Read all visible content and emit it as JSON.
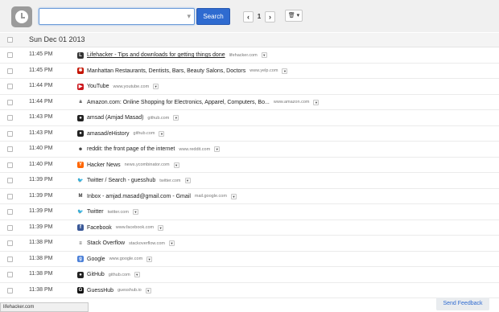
{
  "search": {
    "value": "",
    "placeholder": "",
    "button_label": "Search"
  },
  "pager": {
    "prev": "‹",
    "page": "1",
    "next": "›"
  },
  "trash": {
    "icon": "trash-icon",
    "label": "🗑 ▾"
  },
  "date_header": "Sun Dec 01 2013",
  "rows": [
    {
      "time": "11:45 PM",
      "title": "Lifehacker - Tips and downloads for getting things done",
      "domain": "lifehacker.com",
      "icon": "lifehacker-icon",
      "color": "#333333",
      "glyph": "L",
      "underline": true
    },
    {
      "time": "11:45 PM",
      "title": "Manhattan Restaurants, Dentists, Bars, Beauty Salons, Doctors",
      "domain": "www.yelp.com",
      "icon": "yelp-icon",
      "color": "#c41200",
      "glyph": "✱"
    },
    {
      "time": "11:44 PM",
      "title": "YouTube",
      "domain": "www.youtube.com",
      "icon": "youtube-icon",
      "color": "#cc181e",
      "glyph": "▶"
    },
    {
      "time": "11:44 PM",
      "title": "Amazon.com: Online Shopping for Electronics, Apparel, Computers, Bo...",
      "domain": "www.amazon.com",
      "icon": "amazon-icon",
      "color": "#ffffff",
      "glyph": "a"
    },
    {
      "time": "11:43 PM",
      "title": "amsad (Amjad Masad)",
      "domain": "github.com",
      "icon": "github-icon",
      "color": "#222222",
      "glyph": "●"
    },
    {
      "time": "11:43 PM",
      "title": "amasad/eHistory",
      "domain": "github.com",
      "icon": "github-icon",
      "color": "#222222",
      "glyph": "●"
    },
    {
      "time": "11:40 PM",
      "title": "reddit: the front page of the internet",
      "domain": "www.reddit.com",
      "icon": "reddit-icon",
      "color": "#ffffff",
      "glyph": "☻"
    },
    {
      "time": "11:40 PM",
      "title": "Hacker News",
      "domain": "news.ycombinator.com",
      "icon": "hacker-news-icon",
      "color": "#ff6600",
      "glyph": "Y"
    },
    {
      "time": "11:39 PM",
      "title": "Twitter / Search - guesshub",
      "domain": "twitter.com",
      "icon": "twitter-icon",
      "color": "#ffffff",
      "glyph": "🐦"
    },
    {
      "time": "11:39 PM",
      "title": "Inbox - amjad.masad@gmail.com - Gmail",
      "domain": "mail.google.com",
      "icon": "gmail-icon",
      "color": "#ffffff",
      "glyph": "M"
    },
    {
      "time": "11:39 PM",
      "title": "Twitter",
      "domain": "twitter.com",
      "icon": "twitter-icon",
      "color": "#ffffff",
      "glyph": "🐦"
    },
    {
      "time": "11:39 PM",
      "title": "Facebook",
      "domain": "www.facebook.com",
      "icon": "facebook-icon",
      "color": "#3b5998",
      "glyph": "f"
    },
    {
      "time": "11:38 PM",
      "title": "Stack Overflow",
      "domain": "stackoverflow.com",
      "icon": "stackoverflow-icon",
      "color": "#ffffff",
      "glyph": "≡"
    },
    {
      "time": "11:38 PM",
      "title": "Google",
      "domain": "www.google.com",
      "icon": "google-icon",
      "color": "#4a7fd8",
      "glyph": "g"
    },
    {
      "time": "11:38 PM",
      "title": "GitHub",
      "domain": "github.com",
      "icon": "github-icon",
      "color": "#222222",
      "glyph": "●"
    },
    {
      "time": "11:38 PM",
      "title": "GuessHub",
      "domain": "guesshub.io",
      "icon": "guesshub-icon",
      "color": "#111111",
      "glyph": "G"
    }
  ],
  "status_bar": "lifehacker.com",
  "feedback_label": "Send Feedback"
}
